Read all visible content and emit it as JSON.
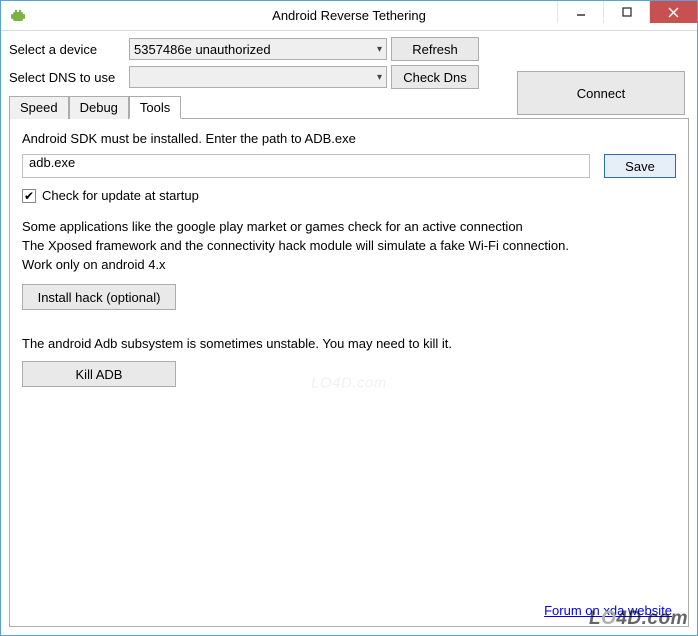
{
  "window": {
    "title": "Android Reverse Tethering"
  },
  "toolbar": {
    "device_label": "Select a device",
    "device_value": "5357486e  unauthorized",
    "dns_label": "Select DNS to use",
    "dns_value": "",
    "refresh_label": "Refresh",
    "checkdns_label": "Check Dns",
    "connect_label": "Connect"
  },
  "tabs": [
    {
      "label": "Speed"
    },
    {
      "label": "Debug"
    },
    {
      "label": "Tools"
    }
  ],
  "tools": {
    "sdk_hint": "Android SDK must be installed. Enter the path to ADB.exe",
    "adb_value": "adb.exe",
    "save_label": "Save",
    "check_update_label": "Check for update at startup",
    "check_update_checked": true,
    "info1": "Some applications like the google play market or games check for an active connection",
    "info2": "The Xposed framework and the connectivity hack module will simulate a fake Wi-Fi connection.",
    "info3": "Work only on android 4.x",
    "install_hack_label": "Install hack (optional)",
    "adb_unstable": "The android Adb subsystem is sometimes unstable. You may need to kill it.",
    "kill_adb_label": "Kill ADB",
    "forum_link": "Forum on xda website"
  },
  "watermark": "LO4D.com"
}
